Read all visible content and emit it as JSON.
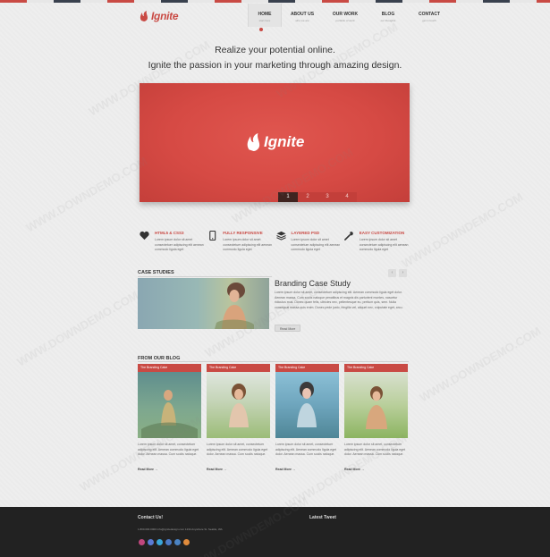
{
  "brand": {
    "name": "Ignite",
    "accent": "#c94a44"
  },
  "nav": {
    "items": [
      {
        "label": "HOME",
        "sub": "start here"
      },
      {
        "label": "ABOUT US",
        "sub": "who we are"
      },
      {
        "label": "OUR WORK",
        "sub": "portfolio of work"
      },
      {
        "label": "BLOG",
        "sub": "our thoughts"
      },
      {
        "label": "CONTACT",
        "sub": "get in touch"
      }
    ],
    "active_index": 0
  },
  "hero": {
    "tagline1": "Realize your potential online.",
    "tagline2": "Ignite the passion in your marketing through amazing design.",
    "slide_logo": "Ignite",
    "pager": [
      "1",
      "2",
      "3",
      "4"
    ],
    "pager_active": 0
  },
  "features": [
    {
      "title": "HTML5 & CSS3",
      "icon": "heart-icon",
      "text": "Lorem ipsum dolor sit amet consectetuer adipiscing elit aenean commodo ligula eget"
    },
    {
      "title": "FULLY RESPONSIVE",
      "icon": "phone-icon",
      "text": "Lorem ipsum dolor sit amet consectetuer adipiscing elit aenean commodo ligula eget"
    },
    {
      "title": "LAYERED PSD",
      "icon": "layers-icon",
      "text": "Lorem ipsum dolor sit amet consectetuer adipiscing elit aenean commodo ligula eget"
    },
    {
      "title": "EASY CUSTOMIZATION",
      "icon": "wrench-icon",
      "text": "Lorem ipsum dolor sit amet consectetuer adipiscing elit aenean commodo ligula eget"
    }
  ],
  "case_studies": {
    "section_title": "CASE STUDIES",
    "title": "Branding Case Study",
    "text": "Lorem ipsum dolor sit amet, consectetuer adipiscing elit. Aenean commodo ligula eget dolor. Aenean massa. Cum sociis natoque penatibus et magnis dis parturient montes, nascetur ridiculus mus. Donec quam felis, ultricies nec, pellentesque eu, pretium quis, sem. Nulla consequat massa quis enim. Donec pede justo, fringilla vel, aliquet nec, vulputate eget, arcu.",
    "button": "Read More",
    "prev": "‹",
    "next": "›"
  },
  "blog": {
    "section_title": "FROM OUR BLOG",
    "posts": [
      {
        "heading": "The Branding Cake",
        "text": "Lorem ipsum dolor sit amet, consectetuer adipiscing elit. Aenean commodo ligula eget dolor. Aenean massa. Cum sociis natoque.",
        "more": "Read More →"
      },
      {
        "heading": "The Branding Cake",
        "text": "Lorem ipsum dolor sit amet, consectetuer adipiscing elit. Aenean commodo ligula eget dolor. Aenean massa. Cum sociis natoque.",
        "more": "Read More →"
      },
      {
        "heading": "The Branding Cake",
        "text": "Lorem ipsum dolor sit amet, consectetuer adipiscing elit. Aenean commodo ligula eget dolor. Aenean massa. Cum sociis natoque.",
        "more": "Read More →"
      },
      {
        "heading": "The Branding Cake",
        "text": "Lorem ipsum dolor sit amet, consectetuer adipiscing elit. Aenean commodo ligula eget dolor. Aenean massa. Cum sociis natoque.",
        "more": "Read More →"
      }
    ]
  },
  "footer": {
    "contact_title": "Contact Us!",
    "tweets_title": "Latest Tweet",
    "contact_info": "1.800.000.0000   info@ignitedesign.com   1234 Anywhere St. Seattle, WA",
    "social_colors": [
      "#c1477e",
      "#5b7bd5",
      "#3aa6d9",
      "#4c7ac5",
      "#4b83c2",
      "#e08b3c"
    ],
    "social_icons": [
      "dribbble-icon",
      "facebook-icon",
      "twitter-icon",
      "linkedin-icon",
      "vimeo-icon",
      "rss-icon"
    ]
  },
  "watermark": "WWW.DOWNDEMO.COM"
}
